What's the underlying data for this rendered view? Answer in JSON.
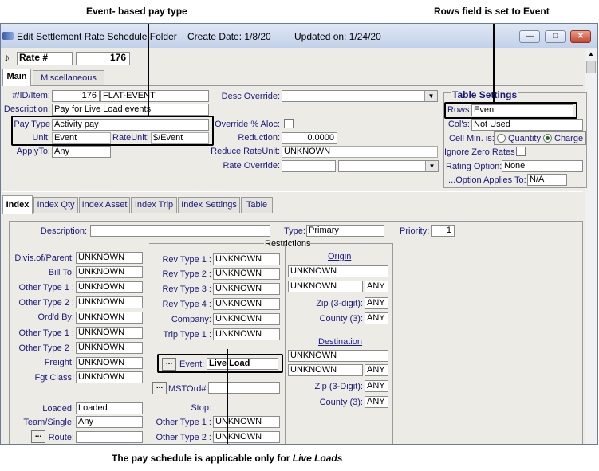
{
  "annotations": {
    "top_left": "Event- based pay type",
    "top_right": "Rows field is set to  Event",
    "bottom": "The pay schedule is applicable only for ",
    "bottom_italic": "Live Loads"
  },
  "window": {
    "title": "Edit Settlement Rate Schedule Folder",
    "create_date": "Create Date: 1/8/20",
    "updated_on": "Updated on: 1/24/20"
  },
  "rate": {
    "label": "Rate #",
    "value": "176"
  },
  "tabs_top": [
    {
      "label": "Main"
    },
    {
      "label": "Miscellaneous"
    }
  ],
  "main": {
    "id_item_label": "#/ID/Item:",
    "id_number": "176",
    "id_value": "FLAT-EVENT",
    "description_label": "Description:",
    "description_value": "Pay for Live Load events",
    "pay_type_label": "Pay Type",
    "pay_type_value": "Activity pay",
    "unit_label": "Unit:",
    "unit_value": "Event",
    "rate_unit_label": "RateUnit:",
    "rate_unit_value": "$/Event",
    "apply_to_label": "ApplyTo:",
    "apply_to_value": "Any",
    "desc_override_label": "Desc Override:",
    "desc_override_value": "",
    "override_aloc_label": "Override % Aloc:",
    "reduction_label": "Reduction:",
    "reduction_value": "0.0000",
    "reduce_rate_unit_label": "Reduce RateUnit:",
    "reduce_rate_unit_value": "UNKNOWN",
    "rate_override_label": "Rate Override:"
  },
  "table_settings": {
    "title": "Table Settings",
    "rows_label": "Rows:",
    "rows_value": "Event",
    "cols_label": "Col's:",
    "cols_value": "Not Used",
    "cell_min_label": "Cell Min. is:",
    "quantity_label": "Quantity",
    "charge_label": "Charge",
    "selected": "Charge",
    "ignore_zero_label": "Ignore Zero Rates",
    "rating_option_label": "Rating Option:",
    "rating_option_value": "None",
    "option_applies_label": "....Option Applies To:",
    "option_applies_value": "N/A"
  },
  "tabs_index": [
    {
      "label": "Index"
    },
    {
      "label": "Index Qty"
    },
    {
      "label": "Index Asset"
    },
    {
      "label": "Index Trip"
    },
    {
      "label": "Index Settings"
    },
    {
      "label": "Table"
    }
  ],
  "index": {
    "description_label": "Description:",
    "description_value": "",
    "type_label": "Type:",
    "type_value": "Primary",
    "priority_label": "Priority:",
    "priority_value": "1",
    "restrictions_label": "Restrictions",
    "col1": [
      {
        "label": "Divis.of/Parent:",
        "value": "UNKNOWN"
      },
      {
        "label": "Bill To:",
        "value": "UNKNOWN"
      },
      {
        "label": "Other Type 1 :",
        "value": "UNKNOWN"
      },
      {
        "label": "Other Type 2 :",
        "value": "UNKNOWN"
      },
      {
        "label": "Ord'd By:",
        "value": "UNKNOWN"
      },
      {
        "label": "Other Type 1 :",
        "value": "UNKNOWN"
      },
      {
        "label": "Other Type 2 :",
        "value": "UNKNOWN"
      },
      {
        "label": "Freight:",
        "value": "UNKNOWN"
      },
      {
        "label": "Fgt Class:",
        "value": "UNKNOWN"
      }
    ],
    "loaded_label": "Loaded:",
    "loaded_value": "Loaded",
    "team_single_label": "Team/Single:",
    "team_single_value": "Any",
    "route_label": "Route:",
    "route_value": "",
    "col2": [
      {
        "label": "Rev Type 1 :",
        "value": "UNKNOWN"
      },
      {
        "label": "Rev Type 2 :",
        "value": "UNKNOWN"
      },
      {
        "label": "Rev Type 3 :",
        "value": "UNKNOWN"
      },
      {
        "label": "Rev Type 4 :",
        "value": "UNKNOWN"
      },
      {
        "label": "Company:",
        "value": "UNKNOWN"
      },
      {
        "label": "Trip Type 1 :",
        "value": "UNKNOWN"
      }
    ],
    "event_label": "Event:",
    "event_value": "Live Load",
    "mstord_label": "MSTOrd#:",
    "mstord_value": "",
    "stop_label": "Stop:",
    "stop_other1_label": "Other Type 1 :",
    "stop_other1_value": "UNKNOWN",
    "stop_other2_label": "Other Type 2 :",
    "stop_other2_value": "UNKNOWN",
    "origin": {
      "title": "Origin",
      "field1": "UNKNOWN",
      "field2": "UNKNOWN",
      "any1": "ANY",
      "zip_label": "Zip (3-digit):",
      "zip_value": "ANY",
      "county_label": "County (3):",
      "county_value": "ANY"
    },
    "destination": {
      "title": "Destination",
      "field1": "UNKNOWN",
      "field2": "UNKNOWN",
      "any1": "ANY",
      "zip_label": "Zip (3-Digit):",
      "zip_value": "ANY",
      "county_label": "County (3):",
      "county_value": "ANY"
    }
  },
  "icons": {
    "app": "app-logo-icon",
    "rate": "note-icon",
    "dropdown": "chevron-down-icon",
    "ellipsis": "ellipsis-button"
  },
  "colors": {
    "label": "#1a1a7a",
    "titlebar": "#c2d1ea",
    "panel": "#ecebe6"
  }
}
